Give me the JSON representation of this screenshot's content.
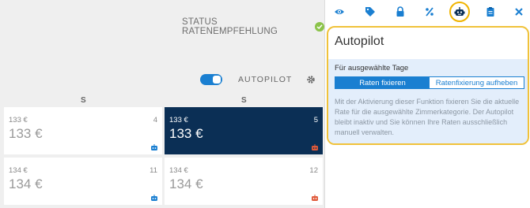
{
  "status": {
    "label": "STATUS RATENEMPFEHLUNG"
  },
  "autopilot_row": {
    "label": "AUTOPILOT"
  },
  "days": [
    {
      "letter": "S"
    },
    {
      "letter": "S"
    }
  ],
  "cells": [
    {
      "price_small": "133 €",
      "price_big": "133 €",
      "count": "4",
      "bot_color": "#1a7fd1"
    },
    {
      "price_small": "133 €",
      "price_big": "133 €",
      "count": "5",
      "bot_color": "#e05a3a"
    },
    {
      "price_small": "134 €",
      "price_big": "134 €",
      "count": "11",
      "bot_color": "#1a7fd1"
    },
    {
      "price_small": "134 €",
      "price_big": "134 €",
      "count": "12",
      "bot_color": "#e05a3a"
    }
  ],
  "toolbar": {
    "icons": [
      "eye-icon",
      "tag-icon",
      "lock-icon",
      "percent-icon",
      "robot-icon",
      "clipboard-icon",
      "close-icon"
    ],
    "active": "robot-icon",
    "icon_color": "#1a7fd1"
  },
  "card": {
    "title": "Autopilot",
    "days_label": "Für ausgewählte Tage",
    "option_fix": "Raten fixieren",
    "option_unfix": "Ratenfixierung aufheben",
    "description": "Mit der Aktivierung dieser Funktion fixieren Sie die aktuelle Rate für die ausgewählte Zimmerkategorie. Der Autopilot bleibt inaktiv und Sie können Ihre Raten ausschließlich manuell verwalten."
  },
  "colors": {
    "accent": "#1a7fd1",
    "highlight": "#f0b400",
    "selected_cell": "#0b2f55"
  }
}
